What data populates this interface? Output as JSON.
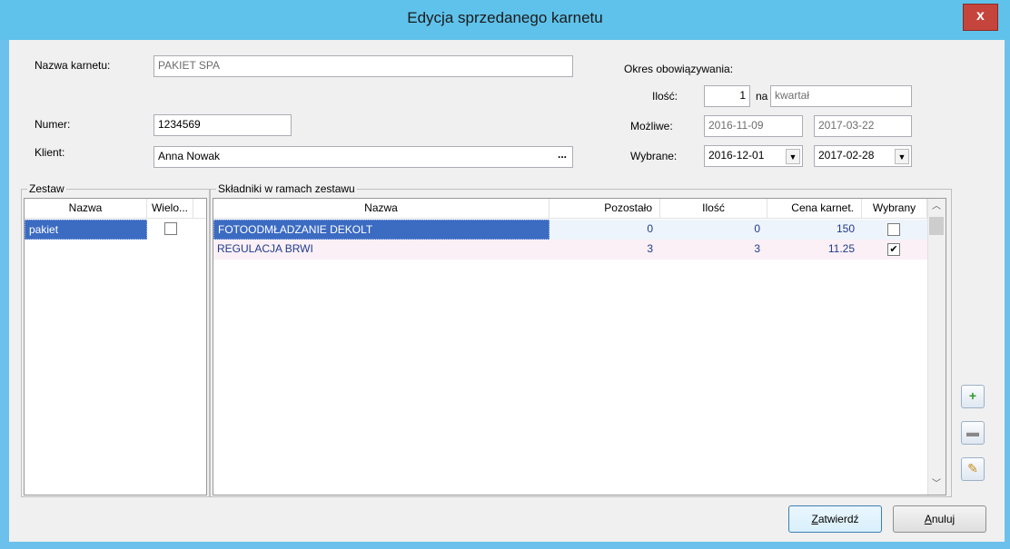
{
  "window": {
    "title": "Edycja sprzedanego karnetu",
    "close_label": "x"
  },
  "form": {
    "nazwa_label": "Nazwa karnetu:",
    "nazwa_value": "PAKIET SPA",
    "numer_label": "Numer:",
    "numer_value": "1234569",
    "klient_label": "Klient:",
    "klient_value": "Anna Nowak",
    "klient_button": "...",
    "okres_label": "Okres obowiązywania:",
    "ilosc_label": "Ilość:",
    "ilosc_value": "1",
    "na_label": "na",
    "okres_unit": "kwartał",
    "mozliwe_label": "Możliwe:",
    "mozliwe_from": "2016-11-09",
    "mozliwe_to": "2017-03-22",
    "wybrane_label": "Wybrane:",
    "wybrane_from": "2016-12-01",
    "wybrane_to": "2017-02-28"
  },
  "zestaw": {
    "group_title": "Zestaw",
    "columns": [
      "Nazwa",
      "Wielo..."
    ],
    "rows": [
      {
        "nazwa": "pakiet",
        "wielo": false
      }
    ]
  },
  "skladniki": {
    "group_title": "Składniki w ramach zestawu",
    "columns": [
      "Nazwa",
      "Pozostało",
      "Ilość",
      "Cena karnet.",
      "Wybrany"
    ],
    "rows": [
      {
        "nazwa": "FOTOODMŁADZANIE DEKOLT",
        "pozostalo": "0",
        "ilosc": "0",
        "cena": "150",
        "wybrany": false
      },
      {
        "nazwa": "REGULACJA BRWI",
        "pozostalo": "3",
        "ilosc": "3",
        "cena": "11.25",
        "wybrany": true
      }
    ]
  },
  "side_buttons": {
    "add_icon": "plus-icon",
    "remove_icon": "minus-icon",
    "edit_icon": "pencil-icon"
  },
  "footer": {
    "confirm_first": "Z",
    "confirm_rest": "atwierdź",
    "cancel_first": "A",
    "cancel_rest": "nuluj"
  },
  "colors": {
    "titlebar": "#5fc2ea",
    "selection": "#3c6bc2",
    "row_text": "#1f3c8c",
    "close": "#c5443b"
  }
}
